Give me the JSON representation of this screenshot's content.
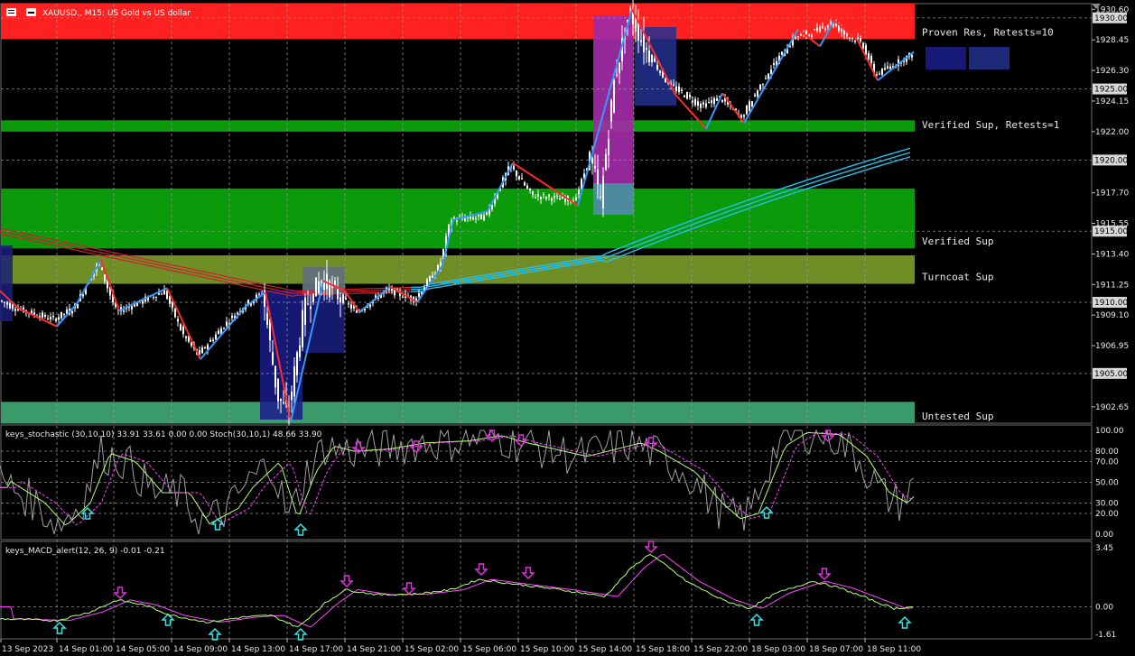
{
  "window": {
    "title": "XAUUSD., M15:  US Gold vs US dollar",
    "icons": [
      "menu-icon",
      "minimize-icon"
    ]
  },
  "main_chart": {
    "symbol": "XAUUSD.",
    "timeframe": "M15",
    "y_axis": {
      "range": [
        1901.5,
        1931.0
      ],
      "ticks": [
        "1930.60",
        "1928.45",
        "1926.30",
        "1924.15",
        "1922.00",
        "1917.70",
        "1915.55",
        "1913.40",
        "1911.25",
        "1909.10",
        "1906.95",
        "1902.65"
      ],
      "tick_values": [
        1930.6,
        1928.45,
        1926.3,
        1924.15,
        1922.0,
        1917.7,
        1915.55,
        1913.4,
        1911.25,
        1909.1,
        1906.95,
        1902.65
      ],
      "boxed_levels": [
        "1930.00",
        "1925.00",
        "1920.00",
        "1915.00",
        "1910.00",
        "1905.00"
      ],
      "boxed_values": [
        1930.0,
        1925.0,
        1920.0,
        1915.0,
        1910.0,
        1905.0
      ]
    },
    "zones": [
      {
        "label": "Proven Res, Retests=10",
        "top": 1931.0,
        "bottom": 1928.5,
        "color": "#ff2020"
      },
      {
        "label": "Verified Sup, Retests=1",
        "top": 1922.8,
        "bottom": 1922.0,
        "color": "#0a9a0a"
      },
      {
        "label": "Verified Sup",
        "top": 1918.0,
        "bottom": 1913.8,
        "color": "#0a9a0a"
      },
      {
        "label": "Turncoat Sup",
        "top": 1913.3,
        "bottom": 1911.3,
        "color": "#6f8f26"
      },
      {
        "label": "Untested Sup",
        "top": 1903.0,
        "bottom": 1901.5,
        "color": "#3a9a6a"
      }
    ]
  },
  "stochastic": {
    "label": "keys_stochastic (30,10,10) 33.91 33.61 0.00 0.00 Stoch(30,10,1) 48.66 33.90",
    "ticks": [
      "100.00",
      "80.00",
      "70.00",
      "50.00",
      "30.00",
      "20.00",
      "0.00"
    ],
    "tick_values": [
      100,
      80,
      70,
      50,
      30,
      20,
      0
    ]
  },
  "macd": {
    "label": "keys_MACD_alert(12, 26, 9) -0.01 -0.21",
    "ticks": [
      "3.45",
      "0.00",
      "-1.61"
    ],
    "tick_values": [
      3.45,
      0.0,
      -1.61
    ]
  },
  "time_axis": {
    "labels": [
      "13 Sep 2023",
      "14 Sep 01:00",
      "14 Sep 05:00",
      "14 Sep 09:00",
      "14 Sep 13:00",
      "14 Sep 17:00",
      "14 Sep 21:00",
      "15 Sep 02:00",
      "15 Sep 06:00",
      "15 Sep 10:00",
      "15 Sep 14:00",
      "15 Sep 18:00",
      "15 Sep 22:00",
      "18 Sep 03:00",
      "18 Sep 07:00",
      "18 Sep 11:00"
    ]
  },
  "colors": {
    "background": "#000000",
    "grid": "#9a9a9a",
    "candle": "#ffffff",
    "zigzag_up": "#3399ff",
    "zigzag_down": "#ff2a2a",
    "ma_up": "#22c0ee",
    "ma_down": "#cc2030",
    "stoch_main": "#a0a0a0",
    "stoch_signal": "#b6ff7a",
    "macd_main": "#b6ff7a",
    "macd_signal": "#ff44ff",
    "arrow_up": "#33e6e6",
    "arrow_down": "#dd33dd"
  }
}
